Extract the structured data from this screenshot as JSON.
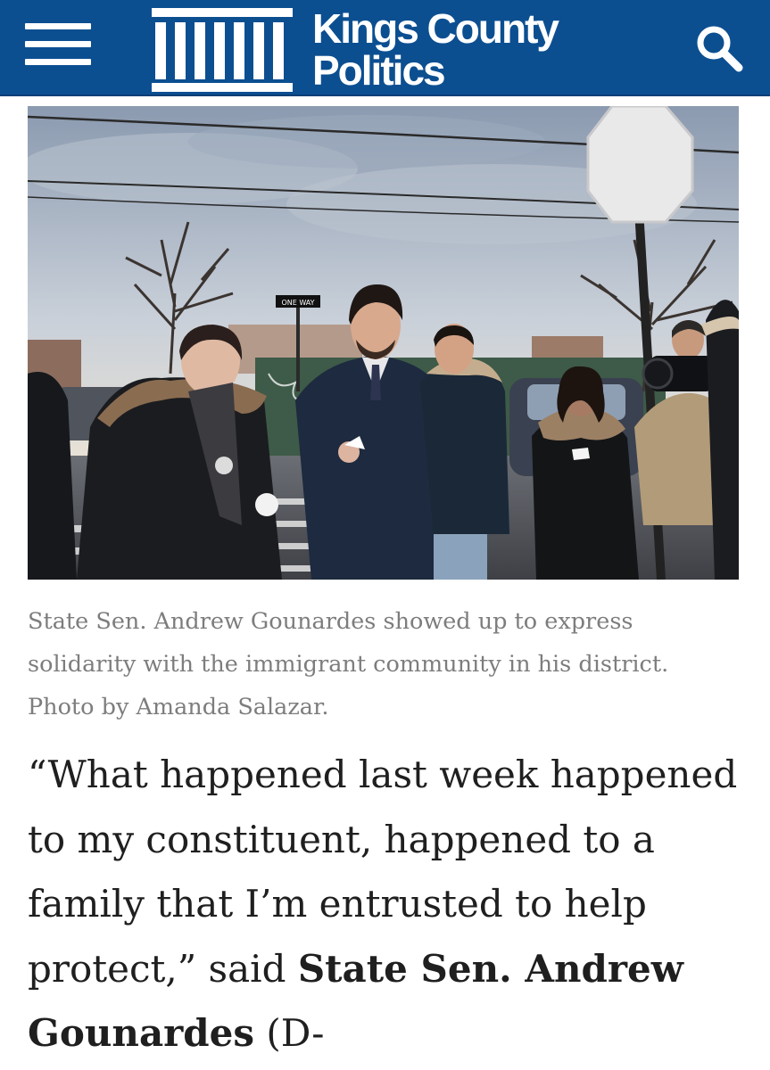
{
  "header": {
    "background_color": "#0c4f91",
    "menu_icon": "hamburger-menu-icon",
    "logo": {
      "line1": "Kings County",
      "line2": "Politics",
      "mark_icon": "columned-building-logo-icon"
    },
    "search_icon": "search-icon"
  },
  "article": {
    "photo": {
      "subject": "street-vigil-photo",
      "sign_text": "ONE WAY"
    },
    "caption": "State Sen. Andrew Gounardes showed up to express solidarity with the immigrant community in his district. Photo by Amanda Salazar.",
    "paragraph": {
      "quote": "“What happened last week happened to my constituent, happened to a family that I’m entrusted to help protect,” said ",
      "speaker": "State Sen. Andrew Gounardes",
      "tail": " (D-"
    }
  }
}
